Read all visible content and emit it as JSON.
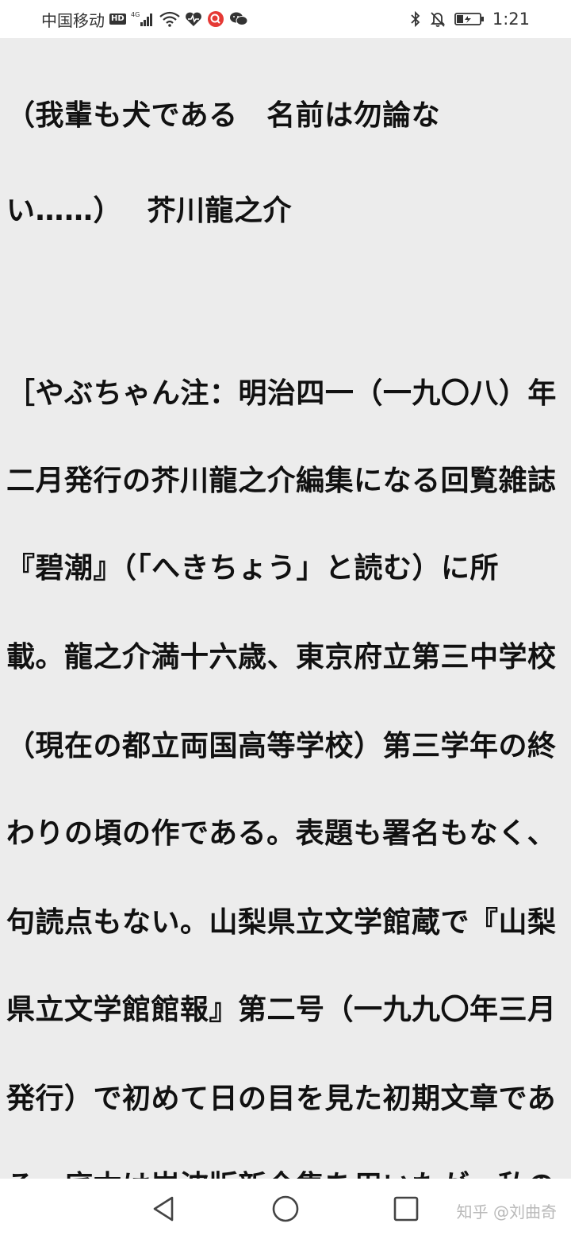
{
  "status_bar": {
    "carrier": "中国移动",
    "hd": "HD",
    "network": "4G",
    "time": "1:21",
    "icons": [
      "signal-icon",
      "wifi-icon",
      "heart-rate-icon",
      "search-app-icon",
      "wechat-icon",
      "bluetooth-icon",
      "mute-bell-icon",
      "battery-icon"
    ]
  },
  "article": {
    "lines": [
      "（我輩も犬である　名前は勿論な",
      "い……）　 芥川龍之介",
      "［やぶちゃん注：明治四一（一九〇八）年",
      "二月発行の芥川龍之介編集になる回覧雑誌",
      "『碧潮』（「へきちょう」と読む）に所",
      "載。龍之介満十六歳、東京府立第三中学校",
      "（現在の都立両国高等学校）第三学年の終",
      "わりの頃の作である。表題も署名もなく、",
      "句読点もない。山梨県立文学館蔵で『山梨",
      "県立文学館館報』第二号（一九九〇年三月",
      "発行）で初めて日の目を見た初期文章であ",
      "る。底本は岩波版新全集を用いたが、私の"
    ]
  },
  "nav": {
    "icons": [
      "back-icon",
      "home-icon",
      "recents-icon"
    ],
    "watermark": "知乎 @刘曲奇"
  }
}
